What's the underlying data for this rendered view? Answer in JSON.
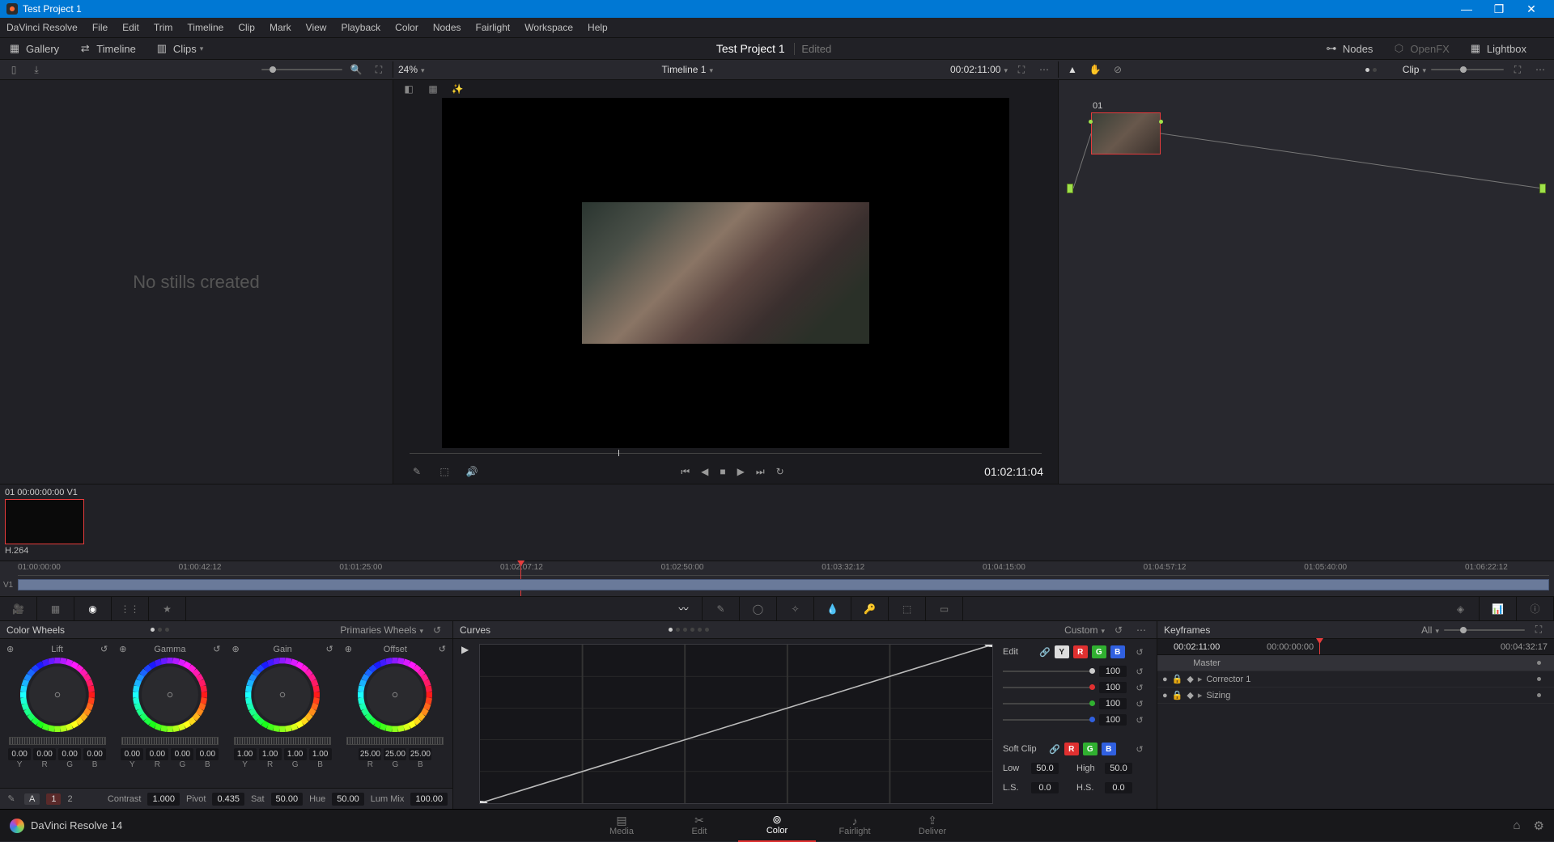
{
  "titlebar": {
    "title": "Test Project 1"
  },
  "menubar": [
    "DaVinci Resolve",
    "File",
    "Edit",
    "Trim",
    "Timeline",
    "Clip",
    "Mark",
    "View",
    "Playback",
    "Color",
    "Nodes",
    "Fairlight",
    "Workspace",
    "Help"
  ],
  "toolbar": {
    "gallery": "Gallery",
    "timeline": "Timeline",
    "clips": "Clips",
    "project": "Test Project 1",
    "dirty": "Edited",
    "nodes": "Nodes",
    "openfx": "OpenFX",
    "lightbox": "Lightbox"
  },
  "subbar": {
    "zoom": "24%",
    "timeline_name": "Timeline 1",
    "timeline_tc": "00:02:11:00",
    "clip_label": "Clip"
  },
  "gallery": {
    "empty": "No stills created"
  },
  "viewer": {
    "timecode": "01:02:11:04"
  },
  "node01": "01",
  "cliprow": {
    "head": "01   00:00:00:00    V1",
    "codec": "H.264"
  },
  "mini_tl": {
    "marks": [
      "01:00:00:00",
      "01:00:42:12",
      "01:01:25:00",
      "01:02:07:12",
      "01:02:50:00",
      "01:03:32:12",
      "01:04:15:00",
      "01:04:57:12",
      "01:05:40:00",
      "01:06:22:12"
    ],
    "vlabel": "V1"
  },
  "wheels": {
    "title": "Color Wheels",
    "mode": "Primaries Wheels",
    "cols": [
      {
        "name": "Lift",
        "vals": [
          "0.00",
          "0.00",
          "0.00",
          "0.00"
        ],
        "lbls": [
          "Y",
          "R",
          "G",
          "B"
        ]
      },
      {
        "name": "Gamma",
        "vals": [
          "0.00",
          "0.00",
          "0.00",
          "0.00"
        ],
        "lbls": [
          "Y",
          "R",
          "G",
          "B"
        ]
      },
      {
        "name": "Gain",
        "vals": [
          "1.00",
          "1.00",
          "1.00",
          "1.00"
        ],
        "lbls": [
          "Y",
          "R",
          "G",
          "B"
        ]
      },
      {
        "name": "Offset",
        "vals": [
          "25.00",
          "25.00",
          "25.00"
        ],
        "lbls": [
          "R",
          "G",
          "B"
        ]
      }
    ],
    "adjust": {
      "a": "A",
      "one": "1",
      "two": "2",
      "contrast_l": "Contrast",
      "contrast_v": "1.000",
      "pivot_l": "Pivot",
      "pivot_v": "0.435",
      "sat_l": "Sat",
      "sat_v": "50.00",
      "hue_l": "Hue",
      "hue_v": "50.00",
      "lum_l": "Lum Mix",
      "lum_v": "100.00"
    }
  },
  "curves": {
    "title": "Curves",
    "mode": "Custom",
    "edit": "Edit",
    "soft": "Soft Clip",
    "rows": [
      {
        "color": "#ccc",
        "val": "100"
      },
      {
        "color": "#e03030",
        "val": "100"
      },
      {
        "color": "#30b030",
        "val": "100"
      },
      {
        "color": "#3060e0",
        "val": "100"
      }
    ],
    "low_l": "Low",
    "low_v": "50.0",
    "high_l": "High",
    "high_v": "50.0",
    "ls_l": "L.S.",
    "ls_v": "0.0",
    "hs_l": "H.S.",
    "hs_v": "0.0"
  },
  "kf": {
    "title": "Keyframes",
    "all": "All",
    "tc_cur": "00:02:11:00",
    "tc_start": "00:00:00:00",
    "tc_end": "00:04:32:17",
    "master": "Master",
    "corrector": "Corrector 1",
    "sizing": "Sizing"
  },
  "bottom": {
    "app": "DaVinci Resolve 14",
    "tabs": [
      "Media",
      "Edit",
      "Color",
      "Fairlight",
      "Deliver"
    ],
    "active": "Color"
  }
}
